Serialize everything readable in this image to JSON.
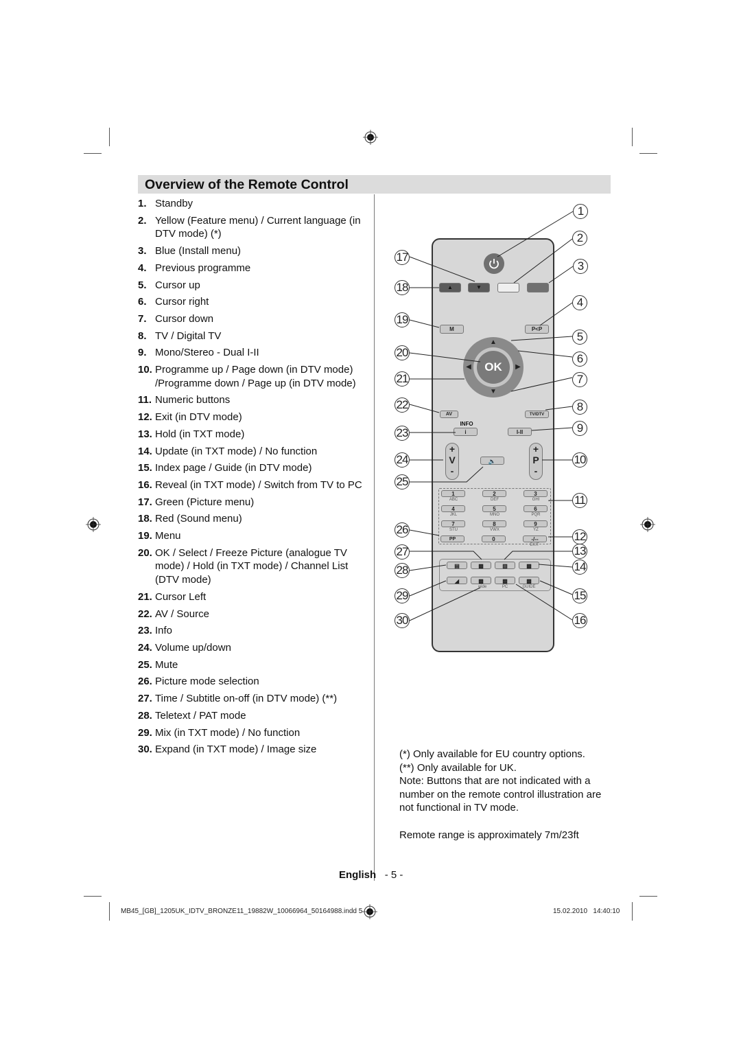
{
  "page": {
    "title": "Overview of the Remote Control",
    "functions": [
      {
        "num": "1.",
        "text": "Standby"
      },
      {
        "num": "2.",
        "text": "Yellow (Feature menu) / Current language (in DTV mode) (*)"
      },
      {
        "num": "3.",
        "text": "Blue (Install menu)"
      },
      {
        "num": "4.",
        "text": "Previous programme"
      },
      {
        "num": "5.",
        "text": "Cursor up"
      },
      {
        "num": "6.",
        "text": "Cursor right"
      },
      {
        "num": "7.",
        "text": "Cursor down"
      },
      {
        "num": "8.",
        "text": "TV / Digital TV"
      },
      {
        "num": "9.",
        "text": "Mono/Stereo - Dual I-II"
      },
      {
        "num": "10.",
        "text": "Programme up / Page down (in DTV mode) /Programme down / Page up (in DTV mode)"
      },
      {
        "num": "11.",
        "text": "Numeric buttons"
      },
      {
        "num": "12.",
        "text": "Exit (in DTV mode)"
      },
      {
        "num": "13.",
        "text": "Hold (in TXT mode)"
      },
      {
        "num": "14.",
        "text": "Update (in TXT mode) / No function"
      },
      {
        "num": "15.",
        "text": "Index page / Guide (in DTV mode)"
      },
      {
        "num": "16.",
        "text": "Reveal (in TXT mode) / Switch from TV to PC"
      },
      {
        "num": "17.",
        "text": "Green (Picture menu)"
      },
      {
        "num": "18.",
        "text": "Red (Sound menu)"
      },
      {
        "num": "19.",
        "text": "Menu"
      },
      {
        "num": "20.",
        "text": "OK / Select / Freeze Picture (analogue TV mode) / Hold (in TXT mode) / Channel List (DTV mode)"
      },
      {
        "num": "21.",
        "text": "Cursor Left"
      },
      {
        "num": "22.",
        "text": "AV / Source"
      },
      {
        "num": "23.",
        "text": "Info"
      },
      {
        "num": "24.",
        "text": "Volume up/down"
      },
      {
        "num": "25.",
        "text": "Mute"
      },
      {
        "num": "26.",
        "text": "Picture mode selection"
      },
      {
        "num": "27.",
        "text": "Time / Subtitle on-off (in DTV mode) (**)"
      },
      {
        "num": "28.",
        "text": "Teletext / PAT mode"
      },
      {
        "num": "29.",
        "text": "Mix (in TXT mode) / No function"
      },
      {
        "num": "30.",
        "text": "Expand (in TXT mode) / Image size"
      }
    ],
    "notes": {
      "eu": "(*) Only available for EU country options.",
      "uk": "(**) Only available for UK.",
      "note": "Note: Buttons that are not indicated with a number on the remote control illustration are not functional in TV mode.",
      "range": "Remote range is approximately 7m/23ft"
    },
    "footer": {
      "language": "English",
      "page_number": "- 5 -",
      "slug": "MB45_[GB]_1205UK_IDTV_BRONZE11_19882W_10066964_50164988.indd   5",
      "date": "15.02.2010",
      "time": "14:40:10"
    }
  },
  "remote": {
    "buttons": {
      "menu": "M",
      "prev_prog": "P<P",
      "ok": "OK",
      "av": "AV",
      "tv_dtv": "TV/DTV",
      "info_label": "INFO",
      "info": "i",
      "dual": "I-II",
      "vol_plus": "+",
      "vol_letter": "V",
      "vol_minus": "-",
      "prog_plus": "+",
      "prog_letter": "P",
      "prog_minus": "-",
      "pp": "PP",
      "exit_btn": "-/--",
      "exit_label": "EXIT",
      "zero": "0",
      "fn_wide": "wide",
      "fn_pc": "PC",
      "fn_guide": "GUIDE"
    },
    "numpad": [
      {
        "digit": "1",
        "letters": "ABC"
      },
      {
        "digit": "2",
        "letters": "DEF"
      },
      {
        "digit": "3",
        "letters": "GHI"
      },
      {
        "digit": "4",
        "letters": "JKL"
      },
      {
        "digit": "5",
        "letters": "MNO"
      },
      {
        "digit": "6",
        "letters": "PQR"
      },
      {
        "digit": "7",
        "letters": "STU"
      },
      {
        "digit": "8",
        "letters": "VWX"
      },
      {
        "digit": "9",
        "letters": "YZ"
      }
    ],
    "callouts": [
      "1",
      "2",
      "3",
      "4",
      "5",
      "6",
      "7",
      "8",
      "9",
      "10",
      "11",
      "12",
      "13",
      "14",
      "15",
      "16",
      "17",
      "18",
      "19",
      "20",
      "21",
      "22",
      "23",
      "24",
      "25",
      "26",
      "27",
      "28",
      "29",
      "30"
    ],
    "colors": {
      "body": "#d7d7d7",
      "red": "#5a5a5a",
      "green": "#5a5a5a",
      "yellow": "#efefef",
      "blue": "#707070",
      "power": "#707070"
    }
  }
}
